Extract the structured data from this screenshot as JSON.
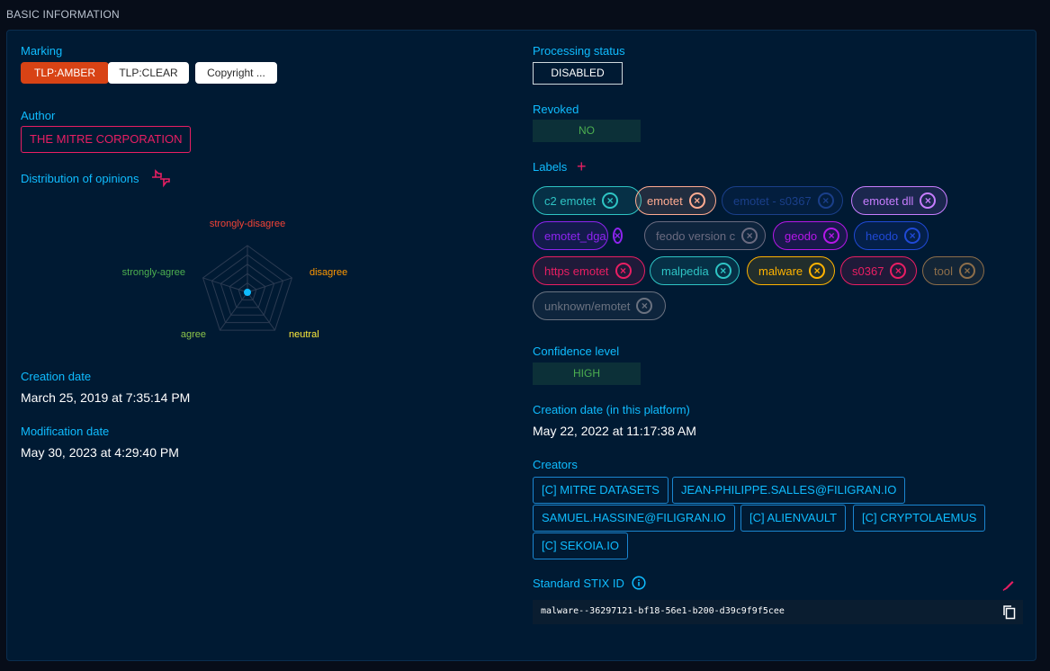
{
  "section_title": "BASIC INFORMATION",
  "left": {
    "marking_label": "Marking",
    "markings": [
      "TLP:AMBER",
      "TLP:CLEAR",
      "Copyright ..."
    ],
    "author_label": "Author",
    "author": "THE MITRE CORPORATION",
    "opinions_label": "Distribution of opinions",
    "radar_axes": [
      "strongly-disagree",
      "disagree",
      "neutral",
      "agree",
      "strongly-agree"
    ],
    "radar_colors": [
      "#f44336",
      "#ff9800",
      "#ffeb3b",
      "#8bc34a",
      "#4caf50"
    ],
    "creation_date_label": "Creation date",
    "creation_date": "March 25, 2019 at 7:35:14 PM",
    "modification_date_label": "Modification date",
    "modification_date": "May 30, 2023 at 4:29:40 PM"
  },
  "right": {
    "processing_status_label": "Processing status",
    "processing_status": "DISABLED",
    "revoked_label": "Revoked",
    "revoked": "NO",
    "labels_label": "Labels",
    "labels": [
      {
        "text": "c2 emotet",
        "color": "#2ec4c4"
      },
      {
        "text": "emotet",
        "color": "#ffab91"
      },
      {
        "text": "emotet - s0367",
        "color": "#1a3f8a"
      },
      {
        "text": "emotet dll",
        "color": "#c77dff"
      },
      {
        "text": "emotet_dga",
        "color": "#8e24f0"
      },
      {
        "text": "feodo version c",
        "color": "#6b6b80"
      },
      {
        "text": "geodo",
        "color": "#b517e8"
      },
      {
        "text": "heodo",
        "color": "#2049d6"
      },
      {
        "text": "https emotet",
        "color": "#e91e63"
      },
      {
        "text": "malpedia",
        "color": "#2ec4c4"
      },
      {
        "text": "malware",
        "color": "#ffb300"
      },
      {
        "text": "s0367",
        "color": "#e91e63"
      },
      {
        "text": "tool",
        "color": "#8d6e4a"
      },
      {
        "text": "unknown/emotet",
        "color": "#6b7280"
      }
    ],
    "confidence_label": "Confidence level",
    "confidence": "HIGH",
    "platform_creation_label": "Creation date (in this platform)",
    "platform_creation": "May 22, 2022 at 11:17:38 AM",
    "creators_label": "Creators",
    "creators": [
      "[C] MITRE DATASETS",
      "JEAN-PHILIPPE.SALLES@FILIGRAN.IO",
      "SAMUEL.HASSINE@FILIGRAN.IO",
      "[C] ALIENVAULT",
      "[C] CRYPTOLAEMUS",
      "[C] SEKOIA.IO"
    ],
    "stix_label": "Standard STIX ID",
    "stix_id": "malware--36297121-bf18-56e1-b200-d39c9f9f5cee"
  },
  "colors": {
    "accent": "#0fbcff",
    "background": "#001a33",
    "pink": "#e91e63",
    "amber": "#d84315"
  }
}
